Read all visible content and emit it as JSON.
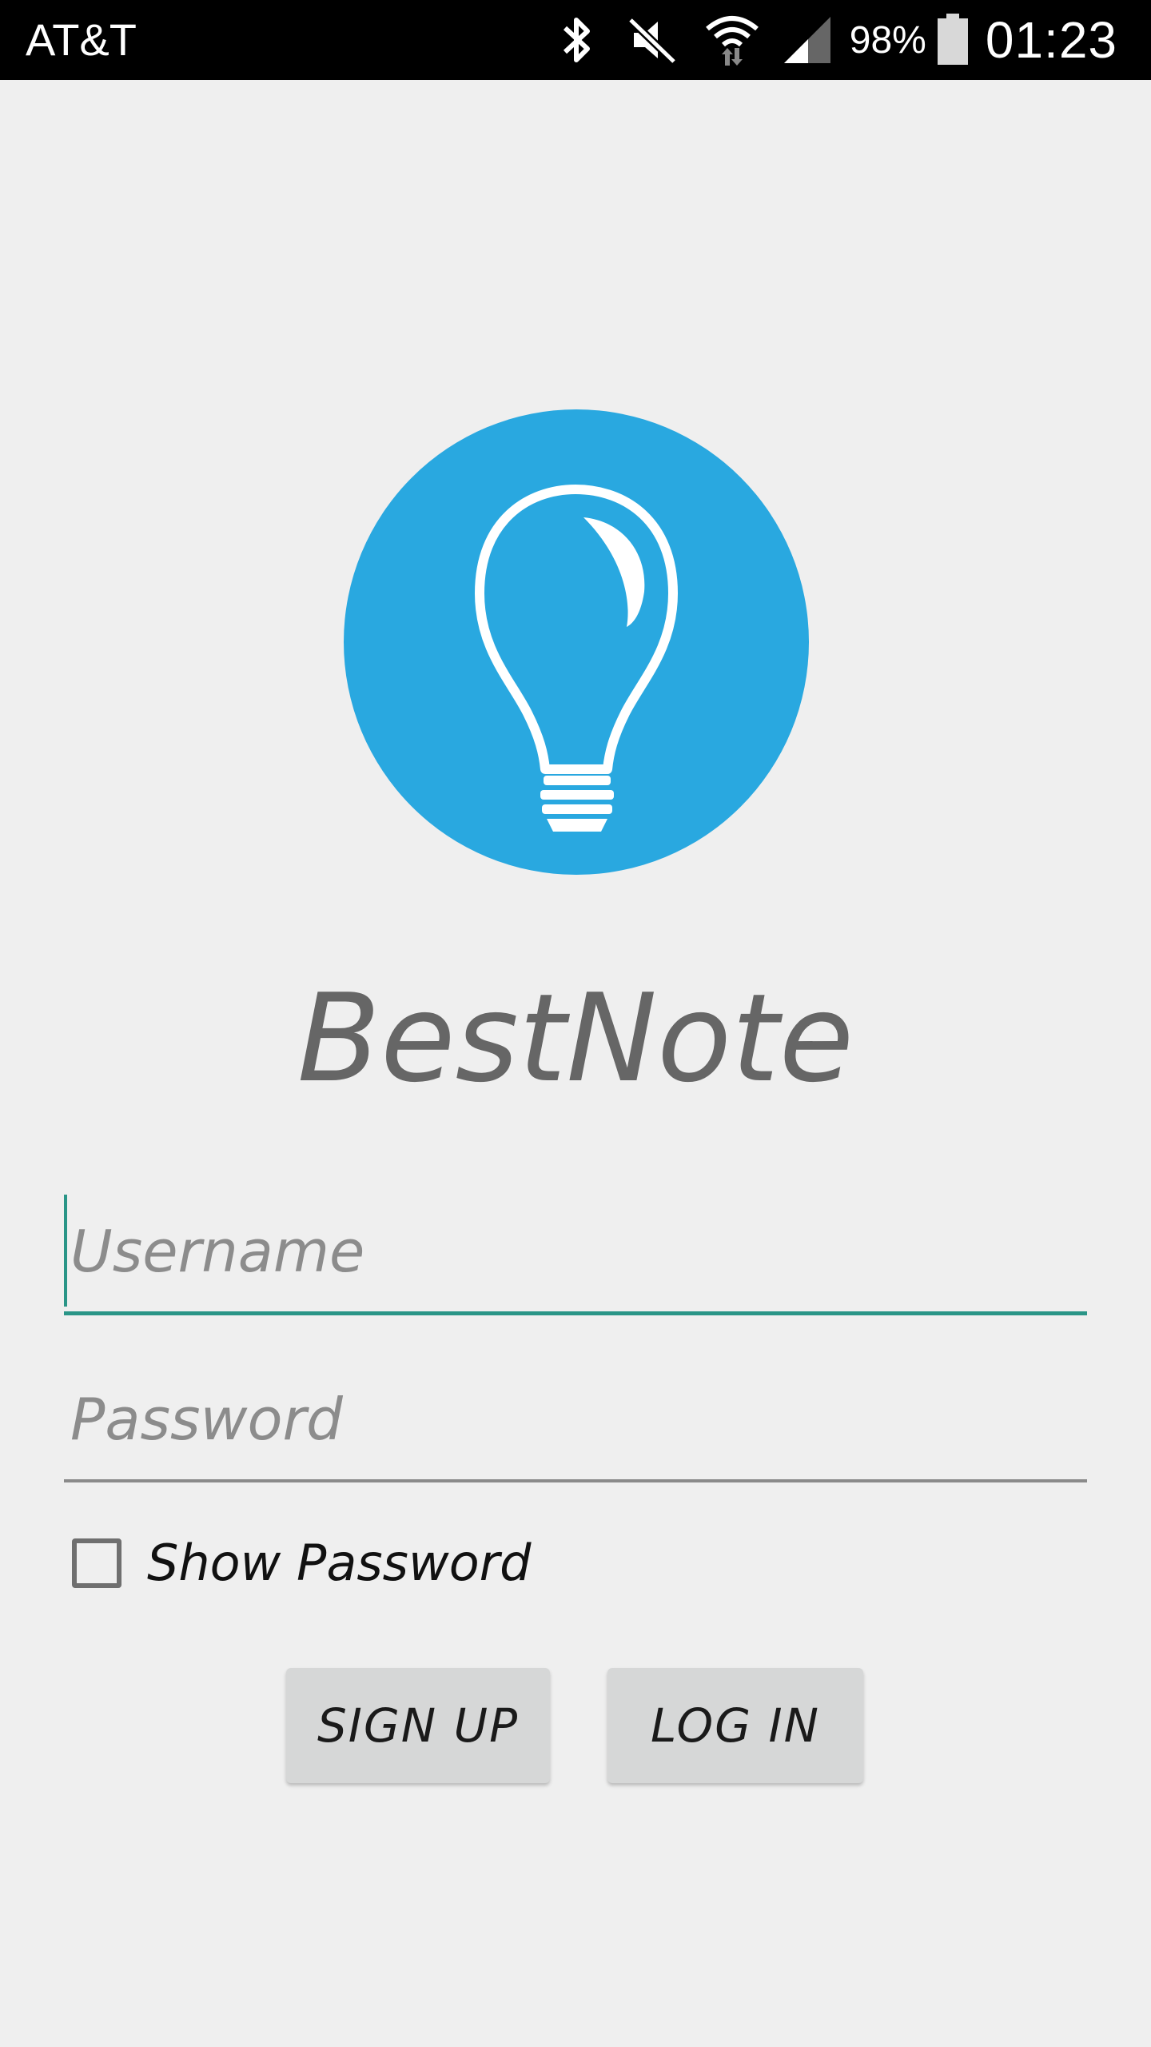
{
  "status_bar": {
    "carrier": "AT&T",
    "battery_percent": "98%",
    "time": "01:23",
    "icons": [
      "bluetooth-icon",
      "mute-icon",
      "wifi-icon",
      "signal-icon",
      "battery-icon"
    ]
  },
  "app": {
    "title": "BestNote",
    "logo_icon": "lightbulb-icon",
    "brand_color": "#29a8e0",
    "accent_color": "#2a9587"
  },
  "form": {
    "username_placeholder": "Username",
    "username_value": "",
    "password_placeholder": "Password",
    "password_value": "",
    "show_password_label": "Show Password",
    "show_password_checked": false
  },
  "buttons": {
    "signup_label": "SIGN UP",
    "login_label": "LOG IN"
  }
}
